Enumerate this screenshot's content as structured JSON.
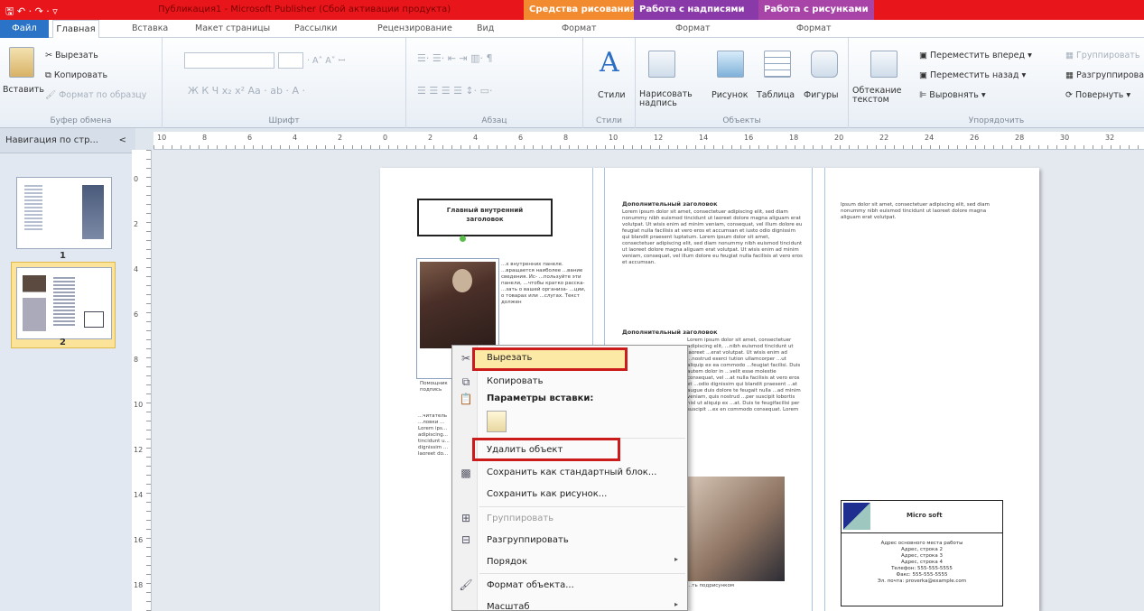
{
  "title_bar": {
    "quick_access": "🖫 ↶ · ↷ · ▿",
    "window_title": "Публикация1 - Microsoft Publisher (Сбой активации продукта)",
    "context_headers": [
      "Средства рисования",
      "Работа с надписями",
      "Работа с рисунками"
    ],
    "colors": {
      "title_bg": "#e8161b",
      "drawing_tools": "#f28a30",
      "text_tools": "#8a3aa8",
      "picture_tools": "#a844a8"
    }
  },
  "tabs": {
    "file": "Файл",
    "items": [
      "Главная",
      "Вставка",
      "Макет страницы",
      "Рассылки",
      "Рецензирование",
      "Вид",
      "Формат",
      "Формат",
      "Формат"
    ]
  },
  "ribbon": {
    "clipboard": {
      "paste": "Вставить",
      "cut": "Вырезать",
      "copy": "Копировать",
      "format_painter": "Формат по образцу",
      "label": "Буфер обмена"
    },
    "font": {
      "label": "Шрифт",
      "buttons": "Ж  К  Ч  x₂  x²  Аа ·  ab ·  А ·",
      "size_buttons": "· A˄ A˅  ꟷ"
    },
    "paragraph": {
      "label": "Абзац"
    },
    "styles": {
      "button": "Стили",
      "label": "Стили"
    },
    "objects": {
      "draw_textbox": "Нарисовать надпись",
      "picture": "Рисунок",
      "table": "Таблица",
      "shapes": "Фигуры",
      "label": "Объекты"
    },
    "arrange": {
      "wrap_text": "Обтекание текстом",
      "bring_forward": "Переместить вперед",
      "send_backward": "Переместить назад",
      "align": "Выровнять",
      "group": "Группировать",
      "ungroup": "Разгруппировать",
      "rotate": "Повернуть",
      "label": "Упорядочить"
    }
  },
  "nav_pane": {
    "header": "Навигация по стр...",
    "collapse": "<",
    "pages": [
      "1",
      "2"
    ],
    "selected": "2"
  },
  "ruler": {
    "h_numbers": [
      "10",
      "8",
      "6",
      "4",
      "2",
      "0",
      "2",
      "4",
      "6",
      "8",
      "10",
      "12",
      "14",
      "16",
      "18",
      "20",
      "22",
      "24",
      "26",
      "28",
      "30",
      "32"
    ],
    "v_numbers": [
      "0",
      "2",
      "4",
      "6",
      "8",
      "10",
      "12",
      "14",
      "16",
      "18"
    ]
  },
  "document": {
    "main_heading": "Главный внутренний заголовок",
    "col1_text": "...х внутренних панеле. ...вращается наиболее ...вание сведения. Ис- ...пользуйте эти панели, ...чтобы кратко расска- ...зать о вашей организа- ...ции, о товарах или ...слугах. Текст должен",
    "col1_bottom": "...читатель ...ловки ... Lorem ips... adipiscing... tincidunt u... dignissim ... laoreet do...",
    "caption1": "Помощник подпись рисунка",
    "col2_heading1": "Дополнительный заголовок",
    "col2_text1": "Lorem ipsum dolor sit amet, consectetuer adipiscing elit, sed diam nonummy nibh euismod tincidunt ut laoreet dolore magna aliguam erat volutpat. Ut wisis enim ad minim veniam, consequat, vel illum dolore eu feugiat nulla facilisis at vero eros et accumsan et iusto odio dignissim qui blandit praesent luptatum. Lorem ipsum dolor sit amet, consectetuer adipiscing elit, sed diam nonummy nibh euismod tincidunt ut laoreet dolore magna aliguam erat volutpat. Ut wisis enim ad minim veniam, consequat, vel illum dolore eu feugiat nulla facilisis at vero eros et accumsan.",
    "col2_heading2": "Дополнительный заголовок",
    "col2_text2": "Lorem ipsum dolor sit amet, consectetuer adipiscing elit, ...nibh euismod tincidunt ut laoreet ...erat volutpat. Ut wisis enim ad ...nostrud exerci tution ullamcorper ...ut aliquip ex ea commodo ...feugiat facilisi. Duis autem dolor in ...velit esse molestie consequat, vel ...at nulla facilisis at vero eros et ...odio dignissim qui blandit praesent ...at augue duis dolore te feugait nulla ...ad minim veniam, quis nostrud ...per suscipit lobortis nisl ut aliquip ex ...at. Duis te feugifacilisi per suscipit ...ex en commodo consequat. Lorem",
    "caption2": "...ть подрисунком",
    "col3_text": "Ipsum dolor sit amet, consectetuer adipiscing elit, sed diam nonummy nibh euismod tincidunt ut laoreet dolore magna aliguam erat volutpat.",
    "company": "Micro soft",
    "address_lines": [
      "Адрес основного места работы",
      "Адрес, строка 2",
      "Адрес, строка 3",
      "Адрес, строка 4",
      "Телефон: 555-555-5555",
      "Факс: 555-555-5555",
      "Эл. почта: proverka@example.com"
    ]
  },
  "context_menu": {
    "cut": "Вырезать",
    "copy": "Копировать",
    "paste_options": "Параметры вставки:",
    "delete": "Удалить объект",
    "save_block": "Сохранить как стандартный блок...",
    "save_picture": "Сохранить как рисунок...",
    "group": "Группировать",
    "ungroup": "Разгруппировать",
    "order": "Порядок",
    "format": "Формат объекта...",
    "zoom": "Масштаб"
  }
}
